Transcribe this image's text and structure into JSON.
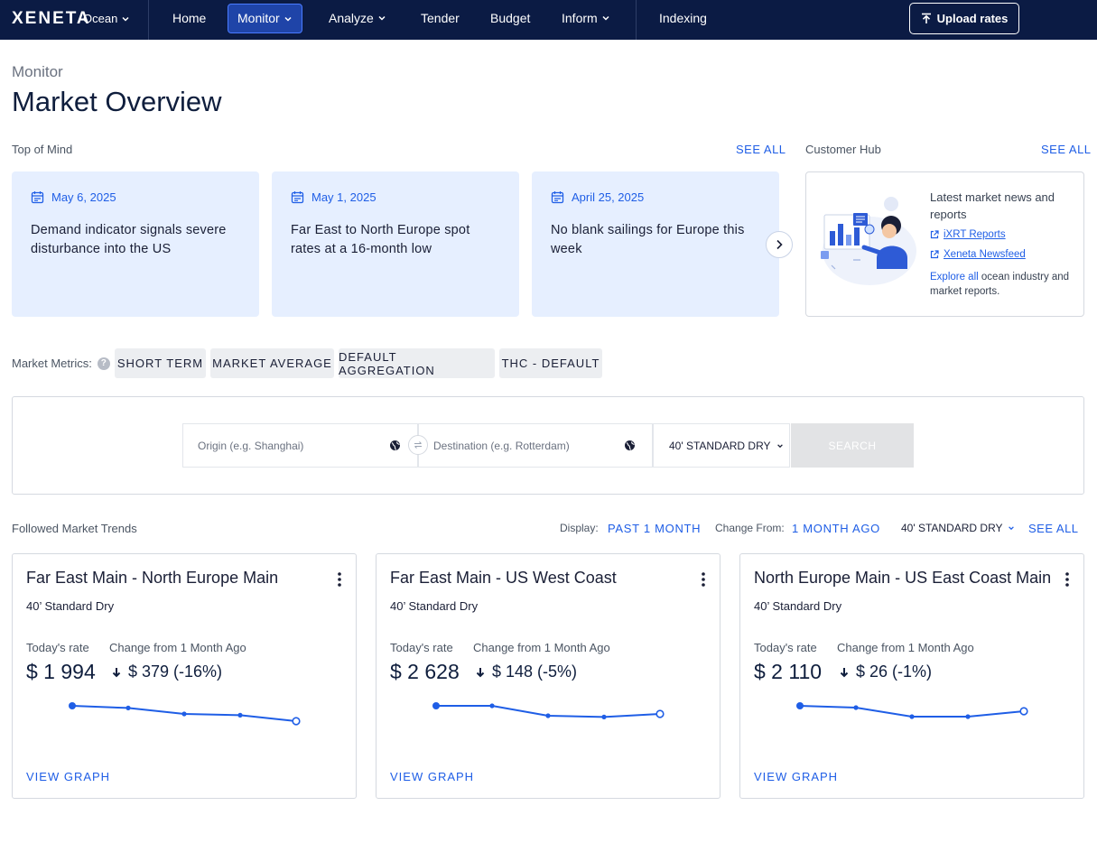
{
  "nav": {
    "logo": "XENETA",
    "product": "Ocean",
    "items": [
      "Home",
      "Monitor",
      "Analyze",
      "Tender",
      "Budget",
      "Inform",
      "Indexing"
    ],
    "upload": "Upload rates"
  },
  "page": {
    "crumb": "Monitor",
    "title": "Market Overview"
  },
  "top_of_mind": {
    "label": "Top of Mind",
    "see_all": "SEE ALL",
    "cards": [
      {
        "date": "May 6, 2025",
        "text": "Demand indicator signals severe disturbance into the US"
      },
      {
        "date": "May 1, 2025",
        "text": "Far East to North Europe spot rates at a 16-month low"
      },
      {
        "date": "April 25, 2025",
        "text": "No blank sailings for Europe this week"
      }
    ]
  },
  "customer_hub": {
    "label": "Customer Hub",
    "see_all": "SEE ALL",
    "heading": "Latest market news and reports",
    "links": [
      "iXRT Reports",
      "Xeneta Newsfeed"
    ],
    "explore_link": "Explore all",
    "explore_rest": " ocean industry and market reports."
  },
  "metrics": {
    "label": "Market Metrics:",
    "chips": [
      "SHORT TERM",
      "MARKET AVERAGE",
      "DEFAULT AGGREGATION",
      "THC - DEFAULT"
    ]
  },
  "search": {
    "origin_placeholder": "Origin (e.g. Shanghai)",
    "destination_placeholder": "Destination (e.g. Rotterdam)",
    "container": "40' STANDARD DRY",
    "button": "SEARCH"
  },
  "trends": {
    "label": "Followed Market Trends",
    "display_label": "Display:",
    "display_value": "PAST 1 MONTH",
    "change_label": "Change From:",
    "change_value": "1 MONTH AGO",
    "container": "40' STANDARD DRY",
    "see_all": "SEE ALL",
    "today_label": "Today's rate",
    "change_from_label": "Change from 1 Month Ago",
    "view_graph": "VIEW GRAPH",
    "cards": [
      {
        "title": "Far East Main - North Europe Main",
        "sub": "40’ Standard Dry",
        "rate": "$ 1 994",
        "change": "$ 379 (-16%)",
        "spark": [
          0.0,
          0.12,
          0.45,
          0.52,
          0.85
        ]
      },
      {
        "title": "Far East Main - US West Coast",
        "sub": "40’ Standard Dry",
        "rate": "$ 2 628",
        "change": "$ 148 (-5%)",
        "spark": [
          0.0,
          0.0,
          0.55,
          0.62,
          0.45
        ]
      },
      {
        "title": "North Europe Main - US East Coast Main",
        "sub": "40’ Standard Dry",
        "rate": "$ 2 110",
        "change": "$ 26 (-1%)",
        "spark": [
          0.0,
          0.1,
          0.6,
          0.6,
          0.3
        ]
      }
    ]
  },
  "colors": {
    "nav_bg": "#0b1b44",
    "accent": "#1f5ee6",
    "card_bg": "#e6efff"
  }
}
